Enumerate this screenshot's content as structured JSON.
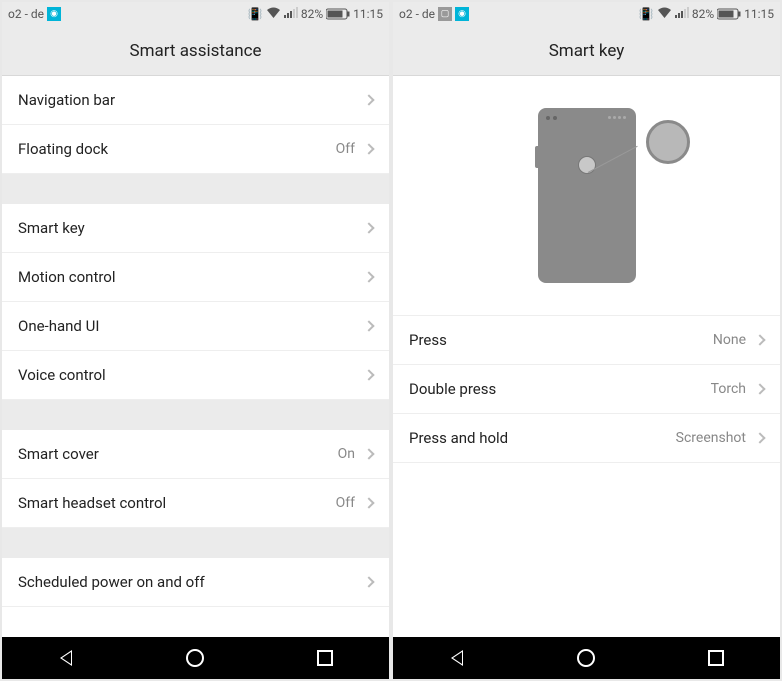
{
  "left": {
    "status": {
      "carrier": "o2 - de",
      "battery_pct": "82%",
      "time": "11:15"
    },
    "header": {
      "title": "Smart assistance"
    },
    "groups": [
      [
        {
          "label": "Navigation bar",
          "value": ""
        },
        {
          "label": "Floating dock",
          "value": "Off"
        }
      ],
      [
        {
          "label": "Smart key",
          "value": ""
        },
        {
          "label": "Motion control",
          "value": ""
        },
        {
          "label": "One-hand UI",
          "value": ""
        },
        {
          "label": "Voice control",
          "value": ""
        }
      ],
      [
        {
          "label": "Smart cover",
          "value": "On"
        },
        {
          "label": "Smart headset control",
          "value": "Off"
        }
      ],
      [
        {
          "label": "Scheduled power on and off",
          "value": ""
        }
      ]
    ]
  },
  "right": {
    "status": {
      "carrier": "o2 - de",
      "battery_pct": "82%",
      "time": "11:15"
    },
    "header": {
      "title": "Smart key"
    },
    "rows": [
      {
        "label": "Press",
        "value": "None"
      },
      {
        "label": "Double press",
        "value": "Torch"
      },
      {
        "label": "Press and hold",
        "value": "Screenshot"
      }
    ]
  }
}
